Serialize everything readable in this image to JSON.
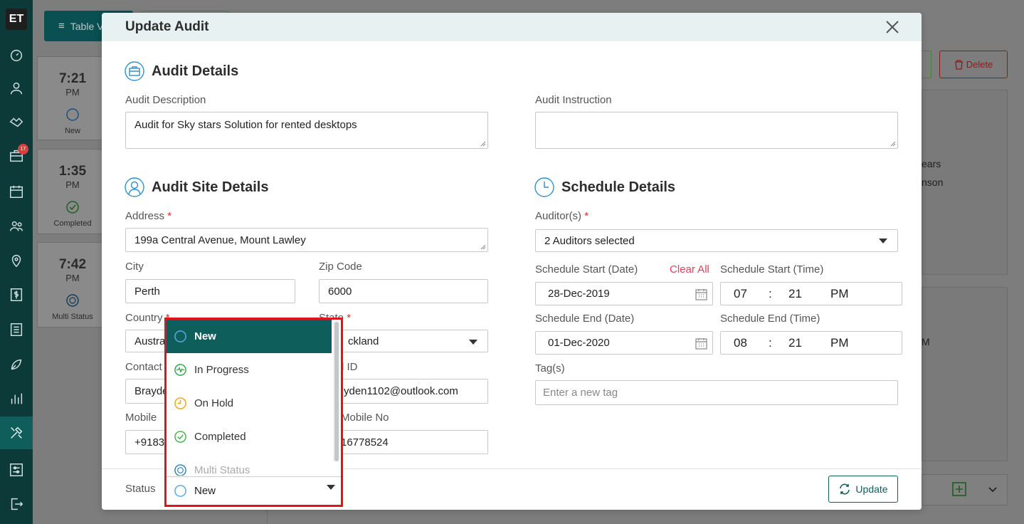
{
  "app": {
    "logo": "ET",
    "notification_count": "17"
  },
  "background": {
    "table_button": "Table V",
    "cards": [
      {
        "time": "7:21",
        "period": "PM",
        "status": "New"
      },
      {
        "time": "1:35",
        "period": "PM",
        "status": "Completed"
      },
      {
        "time": "7:42",
        "period": "PM",
        "status": "Multi Status"
      }
    ],
    "delete_label": "Delete",
    "right_text": [
      "ears",
      "nson",
      "M"
    ]
  },
  "modal": {
    "title": "Update Audit",
    "audit_details": {
      "heading": "Audit Details",
      "description_label": "Audit Description",
      "description_value": "Audit for Sky stars Solution for rented desktops",
      "instruction_label": "Audit Instruction",
      "instruction_value": ""
    },
    "site_details": {
      "heading": "Audit Site Details",
      "address_label": "Address",
      "address_value": "199a Central Avenue, Mount Lawley",
      "city_label": "City",
      "city_value": "Perth",
      "zip_label": "Zip Code",
      "zip_value": "6000",
      "country_label": "Country",
      "country_value": "Austra",
      "state_label": "State",
      "state_value": "ckland",
      "contact_label": "Contact",
      "contact_value": "Brayde",
      "email_label": "l ID",
      "email_value": "yden1102@outlook.com",
      "mobile_label": "Mobile",
      "mobile_value": "+9183",
      "alt_mobile_label": "Mobile No",
      "alt_mobile_value": "16778524",
      "required_mark": "*"
    },
    "schedule": {
      "heading": "Schedule Details",
      "auditors_label": "Auditor(s)",
      "auditors_value": "2 Auditors selected",
      "start_date_label": "Schedule Start (Date)",
      "clear_all": "Clear All",
      "start_date_value": "28-Dec-2019",
      "start_time_label": "Schedule Start (Time)",
      "start_time": {
        "hour": "07",
        "sep": ":",
        "minute": "21",
        "ampm": "PM"
      },
      "end_date_label": "Schedule End (Date)",
      "end_date_value": "01-Dec-2020",
      "end_time_label": "Schedule End (Time)",
      "end_time": {
        "hour": "08",
        "sep": ":",
        "minute": "21",
        "ampm": "PM"
      },
      "tags_label": "Tag(s)",
      "tags_placeholder": "Enter a new tag"
    },
    "status": {
      "label": "Status",
      "selected": "New",
      "options": [
        "New",
        "In Progress",
        "On Hold",
        "Completed",
        "Multi Status"
      ]
    },
    "update_label": "Update"
  },
  "colors": {
    "teal": "#0e5e5b",
    "new": "#2f8fd1",
    "in_progress": "#29a845",
    "on_hold": "#f0a500",
    "completed": "#3cb34a",
    "multi": "#2a7fb5",
    "highlight": "#e0141c"
  }
}
